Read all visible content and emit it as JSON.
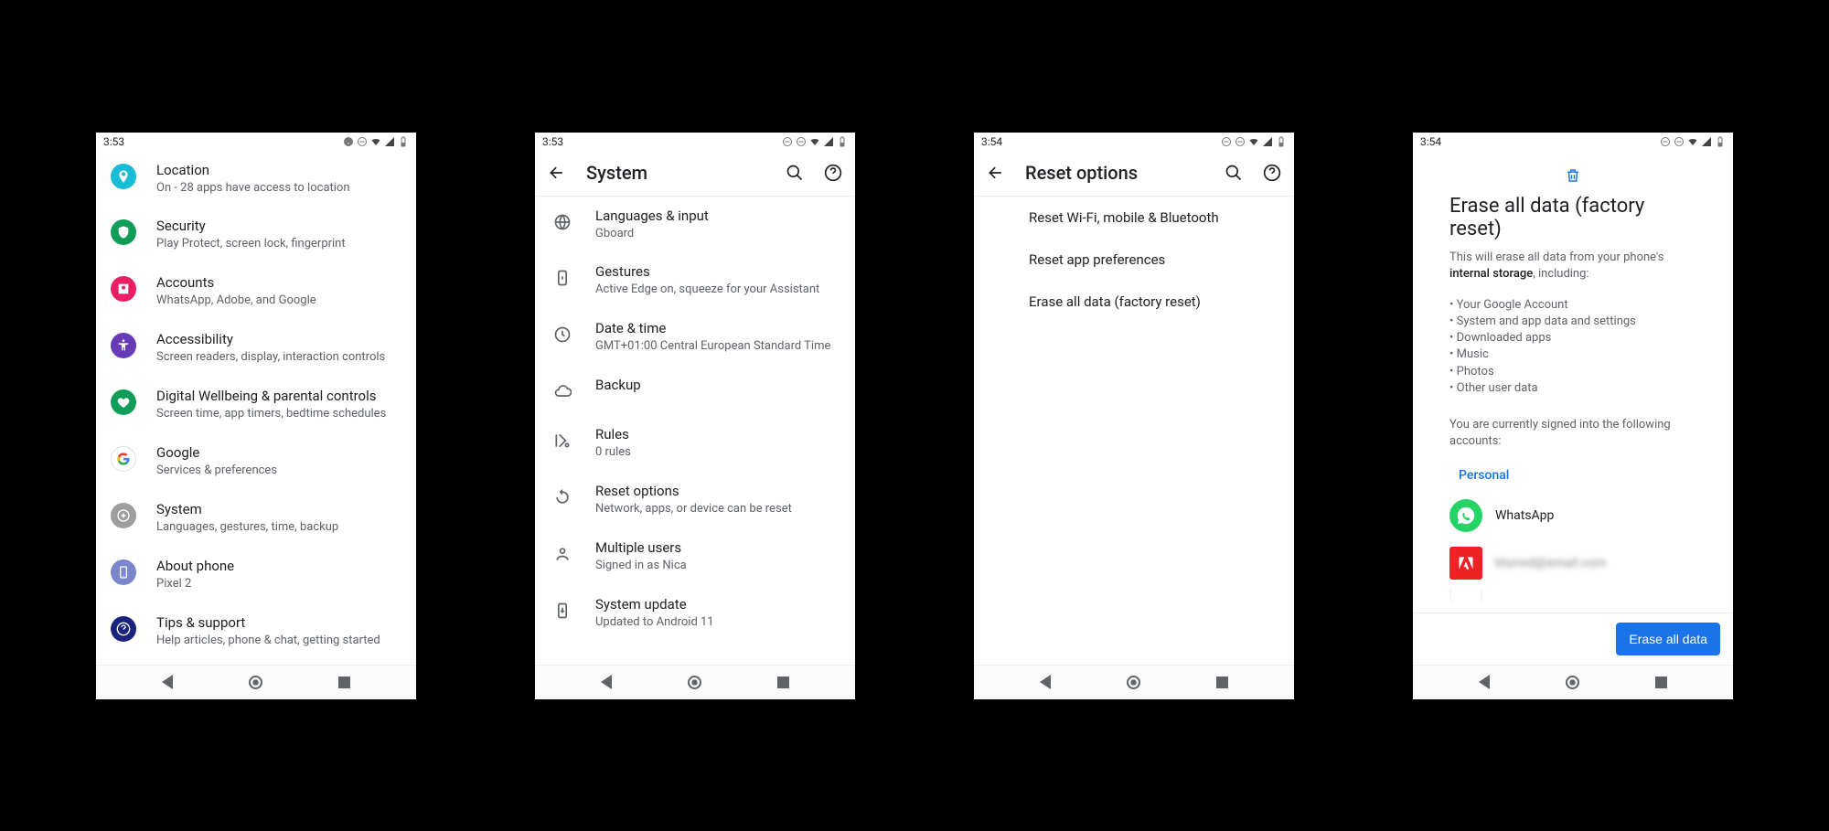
{
  "statusbar": {
    "time1": "3:53",
    "time2": "3:54"
  },
  "screen1": {
    "items": [
      {
        "icon": "location",
        "color": "#18bcd4",
        "title": "Location",
        "sub": "On - 28 apps have access to location"
      },
      {
        "icon": "security",
        "color": "#0f9d58",
        "title": "Security",
        "sub": "Play Protect, screen lock, fingerprint"
      },
      {
        "icon": "accounts",
        "color": "#e91e63",
        "title": "Accounts",
        "sub": "WhatsApp, Adobe, and Google"
      },
      {
        "icon": "accessibility",
        "color": "#673ab7",
        "title": "Accessibility",
        "sub": "Screen readers, display, interaction controls"
      },
      {
        "icon": "wellbeing",
        "color": "#0f9d58",
        "title": "Digital Wellbeing & parental controls",
        "sub": "Screen time, app timers, bedtime schedules"
      },
      {
        "icon": "google",
        "color": "#ffffff",
        "title": "Google",
        "sub": "Services & preferences"
      },
      {
        "icon": "system",
        "color": "#9e9e9e",
        "title": "System",
        "sub": "Languages, gestures, time, backup"
      },
      {
        "icon": "about",
        "color": "#7986cb",
        "title": "About phone",
        "sub": "Pixel 2"
      },
      {
        "icon": "tips",
        "color": "#1a237e",
        "title": "Tips & support",
        "sub": "Help articles, phone & chat, getting started"
      }
    ]
  },
  "screen2": {
    "title": "System",
    "items": [
      {
        "icon": "globe",
        "title": "Languages & input",
        "sub": "Gboard"
      },
      {
        "icon": "gesture",
        "title": "Gestures",
        "sub": "Active Edge on, squeeze for your Assistant"
      },
      {
        "icon": "clock",
        "title": "Date & time",
        "sub": "GMT+01:00 Central European Standard Time"
      },
      {
        "icon": "cloud",
        "title": "Backup",
        "sub": ""
      },
      {
        "icon": "rules",
        "title": "Rules",
        "sub": "0 rules"
      },
      {
        "icon": "reset",
        "title": "Reset options",
        "sub": "Network, apps, or device can be reset"
      },
      {
        "icon": "user",
        "title": "Multiple users",
        "sub": "Signed in as Nica"
      },
      {
        "icon": "update",
        "title": "System update",
        "sub": "Updated to Android 11"
      }
    ]
  },
  "screen3": {
    "title": "Reset options",
    "items": [
      "Reset Wi-Fi, mobile & Bluetooth",
      "Reset app preferences",
      "Erase all data (factory reset)"
    ]
  },
  "screen4": {
    "title": "Erase all data (factory reset)",
    "desc_prefix": "This will erase all data from your phone's ",
    "desc_bold": "internal storage",
    "desc_suffix": ", including:",
    "bullets": [
      "Your Google Account",
      "System and app data and settings",
      "Downloaded apps",
      "Music",
      "Photos",
      "Other user data"
    ],
    "signed_msg": "You are currently signed into the following accounts:",
    "tab": "Personal",
    "accounts": [
      {
        "badge": "whatsapp",
        "label": "WhatsApp",
        "color": "#25d366"
      },
      {
        "badge": "adobe",
        "label": "blurred@email.com",
        "color": "#ed2224",
        "blur": true
      }
    ],
    "button": "Erase all data"
  }
}
